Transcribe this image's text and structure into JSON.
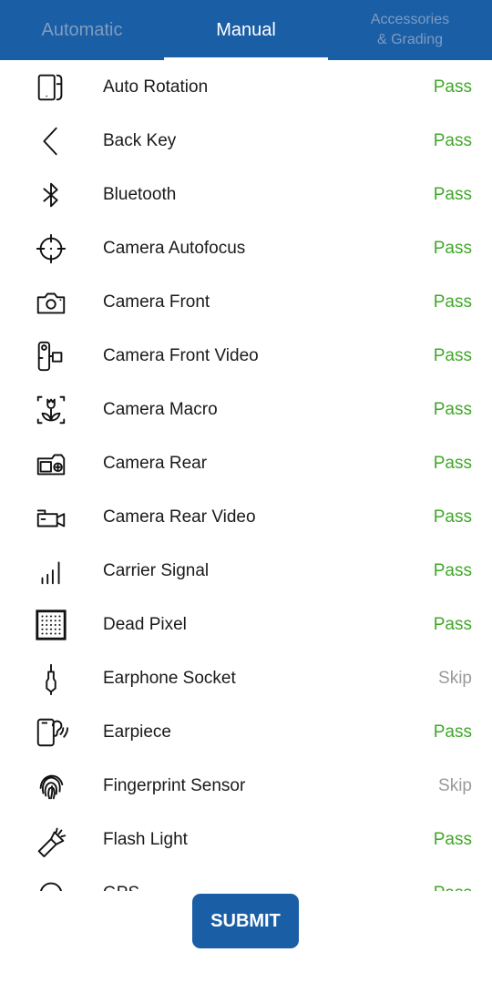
{
  "tabs": [
    {
      "label": "Automatic",
      "active": false
    },
    {
      "label": "Manual",
      "active": true
    },
    {
      "label": "Accessories\n& Grading",
      "active": false
    }
  ],
  "status_colors": {
    "pass": "#3fa827",
    "skip": "#9a9a9a"
  },
  "accent": "#1a5ea6",
  "tests": [
    {
      "label": "Auto Rotation",
      "status": "Pass",
      "icon": "auto-rotation-icon"
    },
    {
      "label": "Back Key",
      "status": "Pass",
      "icon": "back-key-icon"
    },
    {
      "label": "Bluetooth",
      "status": "Pass",
      "icon": "bluetooth-icon"
    },
    {
      "label": "Camera Autofocus",
      "status": "Pass",
      "icon": "crosshair-icon"
    },
    {
      "label": "Camera Front",
      "status": "Pass",
      "icon": "camera-icon"
    },
    {
      "label": "Camera Front Video",
      "status": "Pass",
      "icon": "front-video-icon"
    },
    {
      "label": "Camera Macro",
      "status": "Pass",
      "icon": "macro-flower-icon"
    },
    {
      "label": "Camera Rear",
      "status": "Pass",
      "icon": "rear-camera-icon"
    },
    {
      "label": "Camera Rear Video",
      "status": "Pass",
      "icon": "video-camera-icon"
    },
    {
      "label": "Carrier Signal",
      "status": "Pass",
      "icon": "signal-bars-icon"
    },
    {
      "label": "Dead Pixel",
      "status": "Pass",
      "icon": "pixel-grid-icon"
    },
    {
      "label": "Earphone Socket",
      "status": "Skip",
      "icon": "audio-jack-icon"
    },
    {
      "label": "Earpiece",
      "status": "Pass",
      "icon": "earpiece-icon"
    },
    {
      "label": "Fingerprint Sensor",
      "status": "Skip",
      "icon": "fingerprint-icon"
    },
    {
      "label": "Flash Light",
      "status": "Pass",
      "icon": "flashlight-icon"
    },
    {
      "label": "GPS",
      "status": "Pass",
      "icon": "gps-icon"
    }
  ],
  "submit_label": "SUBMIT"
}
